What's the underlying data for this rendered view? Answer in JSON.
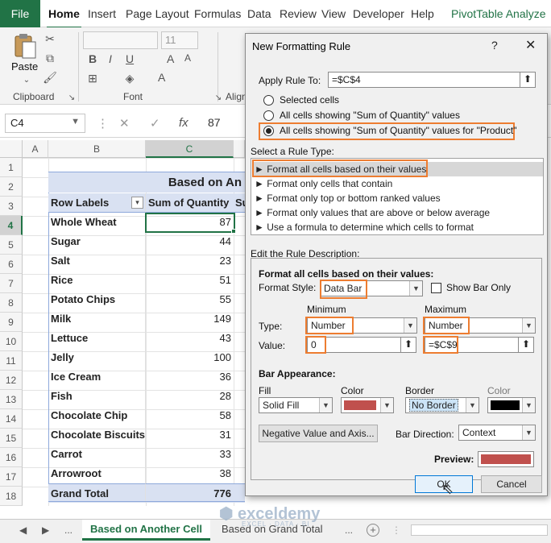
{
  "ribbon_tabs": [
    "File",
    "Home",
    "Insert",
    "Page Layout",
    "Formulas",
    "Data",
    "Review",
    "View",
    "Developer",
    "Help",
    "PivotTable Analyze"
  ],
  "ribbon": {
    "paste_label": "Paste",
    "font_size": "11",
    "clipboard_label": "Clipboard",
    "font_label": "Font",
    "align_label": "Align"
  },
  "formula_bar": {
    "name_box": "C4",
    "value": "87",
    "fx": "fx"
  },
  "columns": [
    "A",
    "B",
    "C"
  ],
  "rows": [
    "1",
    "2",
    "3",
    "4",
    "5",
    "6",
    "7",
    "8",
    "9",
    "10",
    "11",
    "12",
    "13",
    "14",
    "15",
    "16",
    "17",
    "18"
  ],
  "pivot": {
    "title": "Based on An",
    "header_label": "Row Labels",
    "header_value": "Sum of Quantity",
    "header_extra": "Su",
    "items": [
      {
        "label": "Whole Wheat",
        "value": "87"
      },
      {
        "label": "Sugar",
        "value": "44"
      },
      {
        "label": "Salt",
        "value": "23"
      },
      {
        "label": "Rice",
        "value": "51"
      },
      {
        "label": "Potato Chips",
        "value": "55"
      },
      {
        "label": "Milk",
        "value": "149"
      },
      {
        "label": "Lettuce",
        "value": "43"
      },
      {
        "label": "Jelly",
        "value": "100"
      },
      {
        "label": "Ice Cream",
        "value": "36"
      },
      {
        "label": "Fish",
        "value": "28"
      },
      {
        "label": "Chocolate Chip",
        "value": "58"
      },
      {
        "label": "Chocolate Biscuits",
        "value": "31"
      },
      {
        "label": "Carrot",
        "value": "33"
      },
      {
        "label": "Arrowroot",
        "value": "38"
      }
    ],
    "total_label": "Grand Total",
    "total_value": "776"
  },
  "sheet_tabs": {
    "nav_dots": "...",
    "tabs": [
      "Based on Another Cell",
      "Based on Grand Total"
    ],
    "more": "..."
  },
  "watermark": {
    "brand": "exceldemy",
    "tagline": "EXCEL · DATA · BI"
  },
  "dialog": {
    "title": "New Formatting Rule",
    "help": "?",
    "close": "✕",
    "apply_rule_to_label": "Apply Rule To:",
    "apply_rule_to_value": "=$C$4",
    "radio_options": [
      "Selected cells",
      "All cells showing \"Sum of Quantity\" values",
      "All cells showing \"Sum of Quantity\" values for \"Product\""
    ],
    "selected_radio": 2,
    "rule_type_label": "Select a Rule Type:",
    "rule_types": [
      "Format all cells based on their values",
      "Format only cells that contain",
      "Format only top or bottom ranked values",
      "Format only values that are above or below average",
      "Use a formula to determine which cells to format"
    ],
    "selected_rule_type": 0,
    "edit_desc_label": "Edit the Rule Description:",
    "desc_heading": "Format all cells based on their values:",
    "format_style_label": "Format Style:",
    "format_style_value": "Data Bar",
    "show_bar_only": "Show Bar Only",
    "minimum_label": "Minimum",
    "maximum_label": "Maximum",
    "type_label": "Type:",
    "min_type": "Number",
    "max_type": "Number",
    "value_label": "Value:",
    "min_value": "0",
    "max_value": "=$C$9",
    "bar_appearance_label": "Bar Appearance:",
    "fill_label": "Fill",
    "color_label": "Color",
    "border_label": "Border",
    "border_color_label": "Color",
    "fill_value": "Solid Fill",
    "border_value": "No Border",
    "fill_color": "#c0504d",
    "border_color": "#000000",
    "negative_button": "Negative Value and Axis...",
    "bar_direction_label": "Bar Direction:",
    "bar_direction_value": "Context",
    "preview_label": "Preview:",
    "ok": "OK",
    "cancel": "Cancel"
  },
  "colors": {
    "excel_green": "#217346",
    "highlight_orange": "#ed7d31",
    "pivot_blue": "#d9e1f2"
  }
}
